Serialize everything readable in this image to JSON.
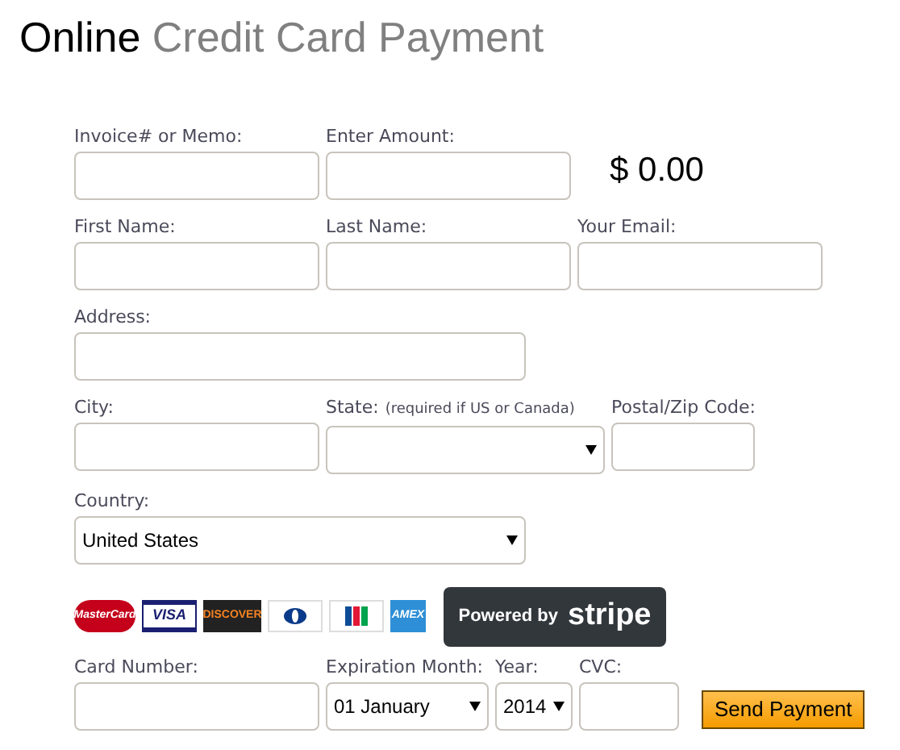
{
  "title": {
    "first": "Online",
    "rest": "Credit Card Payment"
  },
  "rows": [
    [
      {
        "kind": "input",
        "label": "Invoice# or Memo:"
      },
      {
        "kind": "input",
        "label": "Enter Amount:"
      },
      {
        "kind": "amount",
        "value": "$ 0.00"
      }
    ],
    [
      {
        "kind": "input",
        "label": "First Name:"
      },
      {
        "kind": "input",
        "label": "Last Name:"
      },
      {
        "kind": "input",
        "label": "Your Email:"
      }
    ],
    [
      {
        "kind": "input",
        "label": "Address:"
      }
    ],
    [
      {
        "kind": "input",
        "label": "City:"
      },
      {
        "kind": "select",
        "label": "State:",
        "note": "(required if US or Canada)"
      },
      {
        "kind": "input",
        "label": "Postal/Zip Code:"
      }
    ],
    [
      {
        "kind": "select",
        "label": "Country:",
        "value": "United States"
      }
    ]
  ],
  "cards": [
    {
      "kind": "mastercard",
      "text": "MasterCard"
    },
    {
      "kind": "visa",
      "text": "VISA"
    },
    {
      "kind": "discover",
      "text": "DISCOVER"
    },
    {
      "kind": "diners"
    },
    {
      "kind": "jcb"
    },
    {
      "kind": "amex",
      "text": "AMEX"
    }
  ],
  "stripe": {
    "prefix": "Powered by",
    "brand": "stripe"
  },
  "payment_row": [
    {
      "kind": "input",
      "label": "Card Number:"
    },
    {
      "kind": "select",
      "label": "Expiration Month:",
      "value": "01 January"
    },
    {
      "kind": "select",
      "label": "Year:",
      "value": "2014"
    },
    {
      "kind": "input",
      "label": "CVC:"
    }
  ],
  "submit": "Send Payment"
}
